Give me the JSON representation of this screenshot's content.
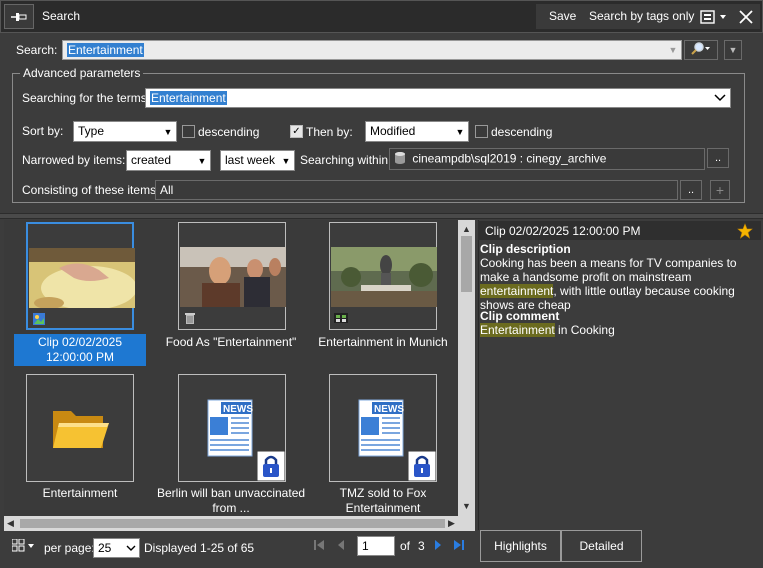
{
  "titlebar": {
    "title": "Search",
    "save_label": "Save",
    "search_by_tags_label": "Search by tags only",
    "pin_icon": "pin-icon",
    "settings_icon": "options-icon",
    "close_icon": "close-icon"
  },
  "search": {
    "label": "Search:",
    "value": "Entertainment"
  },
  "advanced": {
    "title": "Advanced parameters",
    "terms_label": "Searching for the terms:",
    "terms_value": "Entertainment",
    "sort_by_label": "Sort by:",
    "sort_by_value": "Type",
    "descending1_label": "descending",
    "descending1_checked": false,
    "then_by_label": "Then by:",
    "then_by_checked": true,
    "then_by_value": "Modified",
    "descending2_label": "descending",
    "descending2_checked": false,
    "narrowed_label": "Narrowed by items:",
    "narrowed_value1": "created",
    "narrowed_value2": "last week",
    "within_label": "Searching within:",
    "within_value": "cineampdb\\sql2019 : cinegy_archive",
    "consisting_label": "Consisting of these items:",
    "consisting_value": "All",
    "browse_label": "..",
    "add_label": "+"
  },
  "results": [
    {
      "caption": "Clip 02/02/2025 12:00:00 PM",
      "kind": "clip",
      "badge": "image-clip-icon",
      "selected": true
    },
    {
      "caption": "Food As \"Entertainment\"",
      "kind": "clip",
      "badge": "trash-icon",
      "selected": false
    },
    {
      "caption": "Entertainment in Munich",
      "kind": "clip",
      "badge": "filmstrip-icon",
      "selected": false
    },
    {
      "caption": "Entertainment",
      "kind": "folder",
      "badge": "folder-icon",
      "selected": false
    },
    {
      "caption": "Berlin will ban unvaccinated from ...",
      "kind": "news",
      "badge": "lock-icon",
      "selected": false
    },
    {
      "caption": "TMZ sold to Fox Entertainment",
      "kind": "news",
      "badge": "lock-icon",
      "selected": false
    }
  ],
  "details": {
    "header": "Clip 02/02/2025 12:00:00 PM",
    "description_title": "Clip description",
    "description_pre": "Cooking has been a means for TV companies to make a handsome profit on mainstream ",
    "description_hl": "entertainment",
    "description_post": ", with little outlay because cooking shows are cheap",
    "comment_title": "Clip comment",
    "comment_hl": "Entertainment",
    "comment_post": " in Cooking",
    "tab_highlights": "Highlights",
    "tab_detailed": "Detailed"
  },
  "footer": {
    "per_page_label": "per page:",
    "per_page_value": "25",
    "displayed": "Displayed 1-25 of 65",
    "page_value": "1",
    "of_label": "of",
    "total_pages": "3"
  },
  "colors": {
    "background": "#3c3c3c",
    "selection": "#1e78d2",
    "highlight": "#6b6b1f",
    "nav_blue": "#2a7de1"
  }
}
